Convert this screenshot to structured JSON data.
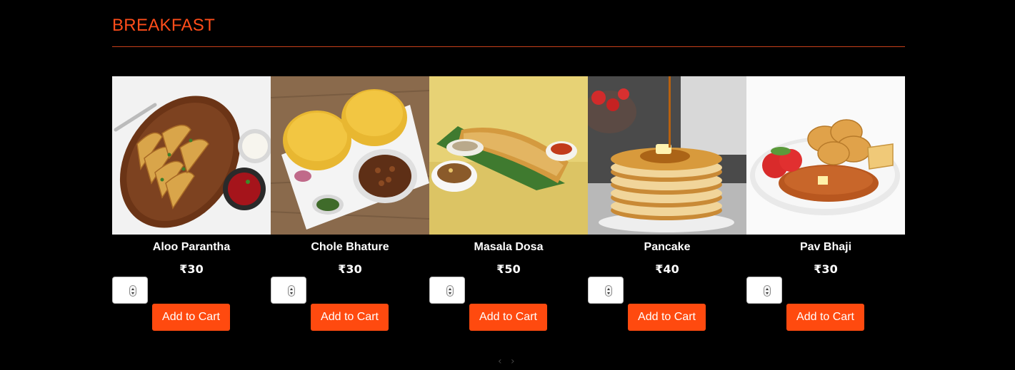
{
  "section": {
    "title": "BREAKFAST"
  },
  "items": [
    {
      "name": "Aloo Parantha",
      "price": "₹30",
      "button": "Add to Cart",
      "quantity": ""
    },
    {
      "name": "Chole Bhature",
      "price": "₹30",
      "button": "Add to Cart",
      "quantity": ""
    },
    {
      "name": "Masala Dosa",
      "price": "₹50",
      "button": "Add to Cart",
      "quantity": ""
    },
    {
      "name": "Pancake",
      "price": "₹40",
      "button": "Add to Cart",
      "quantity": ""
    },
    {
      "name": "Pav Bhaji",
      "price": "₹30",
      "button": "Add to Cart",
      "quantity": ""
    }
  ],
  "carousel": {
    "prev": "‹",
    "next": "›"
  },
  "colors": {
    "accent": "#ff4a0f",
    "background": "#000000",
    "title": "#ff4d1a"
  }
}
